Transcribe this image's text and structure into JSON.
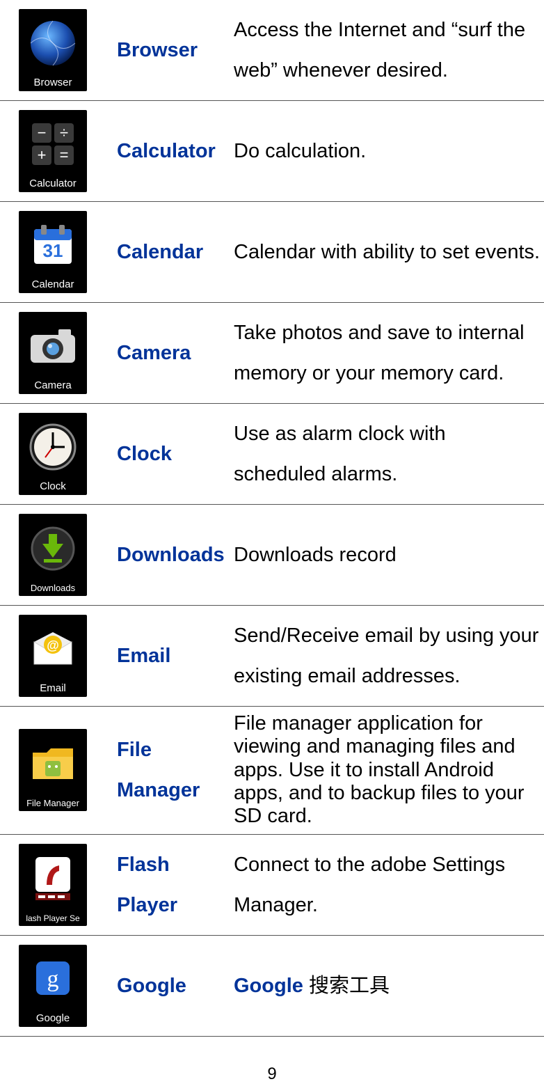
{
  "page_number": "9",
  "rows": [
    {
      "icon_caption": "Browser",
      "name": "Browser",
      "desc": "Access the Internet and “surf the web” whenever desired."
    },
    {
      "icon_caption": "Calculator",
      "name": "Calculator",
      "desc": "Do calculation."
    },
    {
      "icon_caption": "Calendar",
      "name": "Calendar",
      "desc": "Calendar with ability to set events."
    },
    {
      "icon_caption": "Camera",
      "name": "Camera",
      "desc": "Take photos and save to internal memory or your memory card."
    },
    {
      "icon_caption": "Clock",
      "name": "Clock",
      "desc": "Use as alarm clock with scheduled alarms."
    },
    {
      "icon_caption": "Downloads",
      "name": "Downloads",
      "desc": "Downloads record"
    },
    {
      "icon_caption": "Email",
      "name": "Email",
      "desc": "Send/Receive email by using your existing email addresses."
    },
    {
      "icon_caption": "File Manager",
      "name": "File Manager",
      "desc": "File manager application for viewing and managing files and apps. Use it to install Android apps, and to backup files to your SD card."
    },
    {
      "icon_caption": "lash Player Se",
      "name": "Flash Player",
      "desc": "Connect to the adobe Settings Manager."
    },
    {
      "icon_caption": "Google",
      "name": "Google",
      "desc_prefix_bold": "Google ",
      "desc_rest": "搜索工具"
    }
  ]
}
